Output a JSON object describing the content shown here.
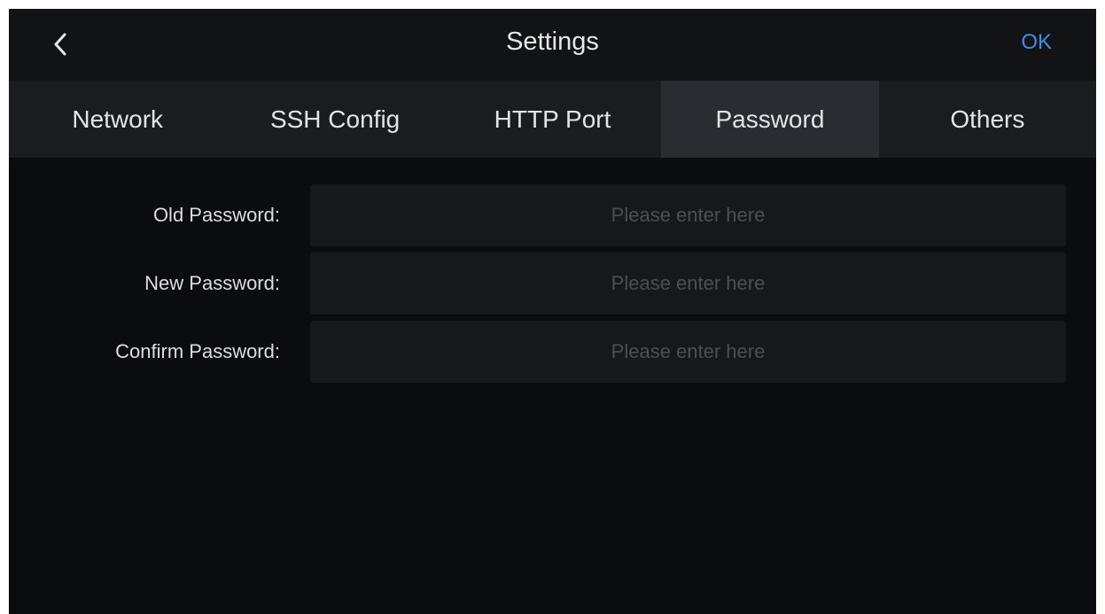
{
  "header": {
    "back_icon": "chevron-left-icon",
    "title": "Settings",
    "ok_label": "OK",
    "ok_color": "#3a8ee6"
  },
  "tabs": [
    {
      "label": "Network",
      "active": false
    },
    {
      "label": "SSH Config",
      "active": false
    },
    {
      "label": "HTTP Port",
      "active": false
    },
    {
      "label": "Password",
      "active": true
    },
    {
      "label": "Others",
      "active": false
    }
  ],
  "form": {
    "old_password": {
      "label": "Old Password:",
      "value": "",
      "placeholder": "Please enter here"
    },
    "new_password": {
      "label": "New Password:",
      "value": "",
      "placeholder": "Please enter here"
    },
    "confirm_password": {
      "label": "Confirm Password:",
      "value": "",
      "placeholder": "Please enter here"
    }
  }
}
